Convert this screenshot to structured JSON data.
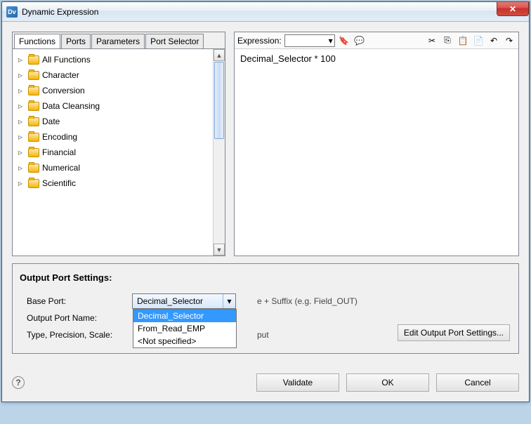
{
  "window": {
    "title": "Dynamic Expression",
    "app_icon_text": "Dv"
  },
  "tabs": {
    "functions": "Functions",
    "ports": "Ports",
    "parameters": "Parameters",
    "port_selector": "Port Selector"
  },
  "tree": {
    "items": [
      "All Functions",
      "Character",
      "Conversion",
      "Data Cleansing",
      "Date",
      "Encoding",
      "Financial",
      "Numerical",
      "Scientific"
    ]
  },
  "expression": {
    "label": "Expression:",
    "text": "Decimal_Selector * 100"
  },
  "toolbar": {
    "cut": "✂",
    "copy": "⎘",
    "paste": "📋",
    "clipboard": "📄",
    "undo": "↶",
    "redo": "↷"
  },
  "settings": {
    "title": "Output Port Settings:",
    "base_port_label": "Base Port:",
    "output_port_name_label": "Output Port Name:",
    "type_label": "Type, Precision, Scale:",
    "base_port_value": "Decimal_Selector",
    "dropdown": [
      "Decimal_Selector",
      "From_Read_EMP",
      "<Not specified>"
    ],
    "suffix_hint": "e + Suffix (e.g. Field_OUT)",
    "type_hint": "put",
    "edit_button": "Edit Output Port Settings..."
  },
  "buttons": {
    "validate": "Validate",
    "ok": "OK",
    "cancel": "Cancel",
    "help": "?"
  },
  "combo_arrow": "▾"
}
